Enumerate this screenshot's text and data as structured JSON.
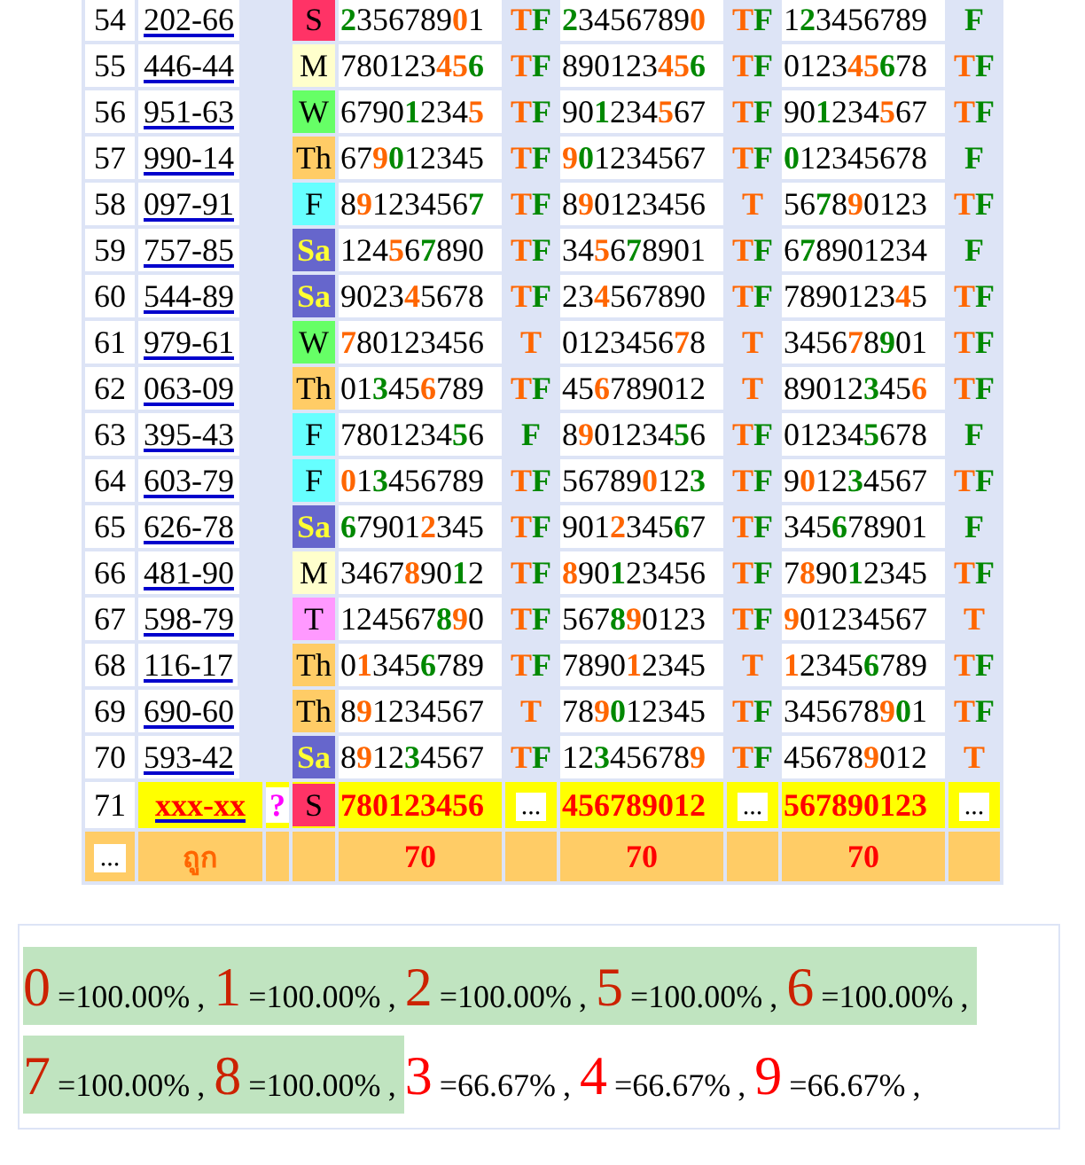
{
  "rows": [
    {
      "no": "54",
      "code": "202-66",
      "day": {
        "label": "S",
        "color": "#ff3366",
        "inverted": false
      },
      "cells": [
        {
          "digits": [
            {
              "text": "2",
              "color": "#008800"
            },
            {
              "text": "356789"
            },
            {
              "text": "0",
              "color": "#ff6600"
            },
            {
              "text": "1"
            }
          ],
          "result": [
            {
              "text": "T",
              "color": "#ff6600"
            },
            {
              "text": "F",
              "color": "#008800"
            }
          ]
        },
        {
          "digits": [
            {
              "text": "2",
              "color": "#008800"
            },
            {
              "text": "3456789"
            },
            {
              "text": "0",
              "color": "#ff6600"
            }
          ],
          "result": [
            {
              "text": "T",
              "color": "#ff6600"
            },
            {
              "text": "F",
              "color": "#008800"
            }
          ]
        },
        {
          "digits": [
            {
              "text": "1"
            },
            {
              "text": "2",
              "color": "#008800"
            },
            {
              "text": "3456789"
            }
          ],
          "result": [
            {
              "text": "F",
              "color": "#008800"
            }
          ]
        }
      ]
    },
    {
      "no": "55",
      "code": "446-44",
      "day": {
        "label": "M",
        "color": "#ffffcc",
        "inverted": false
      },
      "cells": [
        {
          "digits": [
            {
              "text": "780123"
            },
            {
              "text": "45",
              "color": "#ff6600"
            },
            {
              "text": "6",
              "color": "#008800"
            }
          ],
          "result": [
            {
              "text": "T",
              "color": "#ff6600"
            },
            {
              "text": "F",
              "color": "#008800"
            }
          ]
        },
        {
          "digits": [
            {
              "text": "890123"
            },
            {
              "text": "45",
              "color": "#ff6600"
            },
            {
              "text": "6",
              "color": "#008800"
            }
          ],
          "result": [
            {
              "text": "T",
              "color": "#ff6600"
            },
            {
              "text": "F",
              "color": "#008800"
            }
          ]
        },
        {
          "digits": [
            {
              "text": "0123"
            },
            {
              "text": "45",
              "color": "#ff6600"
            },
            {
              "text": "6",
              "color": "#008800"
            },
            {
              "text": "78"
            }
          ],
          "result": [
            {
              "text": "T",
              "color": "#ff6600"
            },
            {
              "text": "F",
              "color": "#008800"
            }
          ]
        }
      ]
    },
    {
      "no": "56",
      "code": "951-63",
      "day": {
        "label": "W",
        "color": "#66ff66",
        "inverted": false
      },
      "cells": [
        {
          "digits": [
            {
              "text": "6790"
            },
            {
              "text": "1",
              "color": "#008800"
            },
            {
              "text": "234"
            },
            {
              "text": "5",
              "color": "#ff6600"
            }
          ],
          "result": [
            {
              "text": "T",
              "color": "#ff6600"
            },
            {
              "text": "F",
              "color": "#008800"
            }
          ]
        },
        {
          "digits": [
            {
              "text": "90"
            },
            {
              "text": "1",
              "color": "#008800"
            },
            {
              "text": "234"
            },
            {
              "text": "5",
              "color": "#ff6600"
            },
            {
              "text": "67"
            }
          ],
          "result": [
            {
              "text": "T",
              "color": "#ff6600"
            },
            {
              "text": "F",
              "color": "#008800"
            }
          ]
        },
        {
          "digits": [
            {
              "text": "90"
            },
            {
              "text": "1",
              "color": "#008800"
            },
            {
              "text": "234"
            },
            {
              "text": "5",
              "color": "#ff6600"
            },
            {
              "text": "67"
            }
          ],
          "result": [
            {
              "text": "T",
              "color": "#ff6600"
            },
            {
              "text": "F",
              "color": "#008800"
            }
          ]
        }
      ]
    },
    {
      "no": "57",
      "code": "990-14",
      "day": {
        "label": "Th",
        "color": "#ffcc66",
        "inverted": false
      },
      "cells": [
        {
          "digits": [
            {
              "text": "67"
            },
            {
              "text": "9",
              "color": "#ff6600"
            },
            {
              "text": "0",
              "color": "#008800"
            },
            {
              "text": "12345"
            }
          ],
          "result": [
            {
              "text": "T",
              "color": "#ff6600"
            },
            {
              "text": "F",
              "color": "#008800"
            }
          ]
        },
        {
          "digits": [
            {
              "text": "9",
              "color": "#ff6600"
            },
            {
              "text": "0",
              "color": "#008800"
            },
            {
              "text": "1234567"
            }
          ],
          "result": [
            {
              "text": "T",
              "color": "#ff6600"
            },
            {
              "text": "F",
              "color": "#008800"
            }
          ]
        },
        {
          "digits": [
            {
              "text": "0",
              "color": "#008800"
            },
            {
              "text": "12345678"
            }
          ],
          "result": [
            {
              "text": "F",
              "color": "#008800"
            }
          ]
        }
      ]
    },
    {
      "no": "58",
      "code": "097-91",
      "day": {
        "label": "F",
        "color": "#66ffff",
        "inverted": false
      },
      "cells": [
        {
          "digits": [
            {
              "text": "8"
            },
            {
              "text": "9",
              "color": "#ff6600"
            },
            {
              "text": "123456"
            },
            {
              "text": "7",
              "color": "#008800"
            }
          ],
          "result": [
            {
              "text": "T",
              "color": "#ff6600"
            },
            {
              "text": "F",
              "color": "#008800"
            }
          ]
        },
        {
          "digits": [
            {
              "text": "8"
            },
            {
              "text": "9",
              "color": "#ff6600"
            },
            {
              "text": "0123456"
            }
          ],
          "result": [
            {
              "text": "T",
              "color": "#ff6600"
            }
          ]
        },
        {
          "digits": [
            {
              "text": "56"
            },
            {
              "text": "7",
              "color": "#008800"
            },
            {
              "text": "8"
            },
            {
              "text": "9",
              "color": "#ff6600"
            },
            {
              "text": "0123"
            }
          ],
          "result": [
            {
              "text": "T",
              "color": "#ff6600"
            },
            {
              "text": "F",
              "color": "#008800"
            }
          ]
        }
      ]
    },
    {
      "no": "59",
      "code": "757-85",
      "day": {
        "label": "Sa",
        "color": "#6666cc",
        "inverted": true
      },
      "cells": [
        {
          "digits": [
            {
              "text": "124"
            },
            {
              "text": "5",
              "color": "#ff6600"
            },
            {
              "text": "6"
            },
            {
              "text": "7",
              "color": "#008800"
            },
            {
              "text": "890"
            }
          ],
          "result": [
            {
              "text": "T",
              "color": "#ff6600"
            },
            {
              "text": "F",
              "color": "#008800"
            }
          ]
        },
        {
          "digits": [
            {
              "text": "34"
            },
            {
              "text": "5",
              "color": "#ff6600"
            },
            {
              "text": "6"
            },
            {
              "text": "7",
              "color": "#008800"
            },
            {
              "text": "8901"
            }
          ],
          "result": [
            {
              "text": "T",
              "color": "#ff6600"
            },
            {
              "text": "F",
              "color": "#008800"
            }
          ]
        },
        {
          "digits": [
            {
              "text": "6"
            },
            {
              "text": "7",
              "color": "#008800"
            },
            {
              "text": "8901234"
            }
          ],
          "result": [
            {
              "text": "F",
              "color": "#008800"
            }
          ]
        }
      ]
    },
    {
      "no": "60",
      "code": "544-89",
      "day": {
        "label": "Sa",
        "color": "#6666cc",
        "inverted": true
      },
      "cells": [
        {
          "digits": [
            {
              "text": "9023"
            },
            {
              "text": "4",
              "color": "#ff6600"
            },
            {
              "text": "5678"
            }
          ],
          "result": [
            {
              "text": "T",
              "color": "#ff6600"
            },
            {
              "text": "F",
              "color": "#008800"
            }
          ]
        },
        {
          "digits": [
            {
              "text": "23"
            },
            {
              "text": "4",
              "color": "#ff6600"
            },
            {
              "text": "567890"
            }
          ],
          "result": [
            {
              "text": "T",
              "color": "#ff6600"
            },
            {
              "text": "F",
              "color": "#008800"
            }
          ]
        },
        {
          "digits": [
            {
              "text": "7890123"
            },
            {
              "text": "4",
              "color": "#ff6600"
            },
            {
              "text": "5"
            }
          ],
          "result": [
            {
              "text": "T",
              "color": "#ff6600"
            },
            {
              "text": "F",
              "color": "#008800"
            }
          ]
        }
      ]
    },
    {
      "no": "61",
      "code": "979-61",
      "day": {
        "label": "W",
        "color": "#66ff66",
        "inverted": false
      },
      "cells": [
        {
          "digits": [
            {
              "text": "7",
              "color": "#ff6600"
            },
            {
              "text": "80123456"
            }
          ],
          "result": [
            {
              "text": "T",
              "color": "#ff6600"
            }
          ]
        },
        {
          "digits": [
            {
              "text": "0123456"
            },
            {
              "text": "7",
              "color": "#ff6600"
            },
            {
              "text": "8"
            }
          ],
          "result": [
            {
              "text": "T",
              "color": "#ff6600"
            }
          ]
        },
        {
          "digits": [
            {
              "text": "3456"
            },
            {
              "text": "7",
              "color": "#ff6600"
            },
            {
              "text": "8"
            },
            {
              "text": "9",
              "color": "#008800"
            },
            {
              "text": "01"
            }
          ],
          "result": [
            {
              "text": "T",
              "color": "#ff6600"
            },
            {
              "text": "F",
              "color": "#008800"
            }
          ]
        }
      ]
    },
    {
      "no": "62",
      "code": "063-09",
      "day": {
        "label": "Th",
        "color": "#ffcc66",
        "inverted": false
      },
      "cells": [
        {
          "digits": [
            {
              "text": "01"
            },
            {
              "text": "3",
              "color": "#008800"
            },
            {
              "text": "45"
            },
            {
              "text": "6",
              "color": "#ff6600"
            },
            {
              "text": "789"
            }
          ],
          "result": [
            {
              "text": "T",
              "color": "#ff6600"
            },
            {
              "text": "F",
              "color": "#008800"
            }
          ]
        },
        {
          "digits": [
            {
              "text": "45"
            },
            {
              "text": "6",
              "color": "#ff6600"
            },
            {
              "text": "789012"
            }
          ],
          "result": [
            {
              "text": "T",
              "color": "#ff6600"
            }
          ]
        },
        {
          "digits": [
            {
              "text": "89012"
            },
            {
              "text": "3",
              "color": "#008800"
            },
            {
              "text": "45"
            },
            {
              "text": "6",
              "color": "#ff6600"
            }
          ],
          "result": [
            {
              "text": "T",
              "color": "#ff6600"
            },
            {
              "text": "F",
              "color": "#008800"
            }
          ]
        }
      ]
    },
    {
      "no": "63",
      "code": "395-43",
      "day": {
        "label": "F",
        "color": "#66ffff",
        "inverted": false
      },
      "cells": [
        {
          "digits": [
            {
              "text": "7801234"
            },
            {
              "text": "5",
              "color": "#008800"
            },
            {
              "text": "6"
            }
          ],
          "result": [
            {
              "text": "F",
              "color": "#008800"
            }
          ]
        },
        {
          "digits": [
            {
              "text": "8"
            },
            {
              "text": "9",
              "color": "#ff6600"
            },
            {
              "text": "01234"
            },
            {
              "text": "5",
              "color": "#008800"
            },
            {
              "text": "6"
            }
          ],
          "result": [
            {
              "text": "T",
              "color": "#ff6600"
            },
            {
              "text": "F",
              "color": "#008800"
            }
          ]
        },
        {
          "digits": [
            {
              "text": "01234"
            },
            {
              "text": "5",
              "color": "#008800"
            },
            {
              "text": "678"
            }
          ],
          "result": [
            {
              "text": "F",
              "color": "#008800"
            }
          ]
        }
      ]
    },
    {
      "no": "64",
      "code": "603-79",
      "day": {
        "label": "F",
        "color": "#66ffff",
        "inverted": false
      },
      "cells": [
        {
          "digits": [
            {
              "text": "0",
              "color": "#ff6600"
            },
            {
              "text": "1"
            },
            {
              "text": "3",
              "color": "#008800"
            },
            {
              "text": "456789"
            }
          ],
          "result": [
            {
              "text": "T",
              "color": "#ff6600"
            },
            {
              "text": "F",
              "color": "#008800"
            }
          ]
        },
        {
          "digits": [
            {
              "text": "56789"
            },
            {
              "text": "0",
              "color": "#ff6600"
            },
            {
              "text": "12"
            },
            {
              "text": "3",
              "color": "#008800"
            }
          ],
          "result": [
            {
              "text": "T",
              "color": "#ff6600"
            },
            {
              "text": "F",
              "color": "#008800"
            }
          ]
        },
        {
          "digits": [
            {
              "text": "9"
            },
            {
              "text": "0",
              "color": "#ff6600"
            },
            {
              "text": "12"
            },
            {
              "text": "3",
              "color": "#008800"
            },
            {
              "text": "4567"
            }
          ],
          "result": [
            {
              "text": "T",
              "color": "#ff6600"
            },
            {
              "text": "F",
              "color": "#008800"
            }
          ]
        }
      ]
    },
    {
      "no": "65",
      "code": "626-78",
      "day": {
        "label": "Sa",
        "color": "#6666cc",
        "inverted": true
      },
      "cells": [
        {
          "digits": [
            {
              "text": "6",
              "color": "#008800"
            },
            {
              "text": "7901"
            },
            {
              "text": "2",
              "color": "#ff6600"
            },
            {
              "text": "345"
            }
          ],
          "result": [
            {
              "text": "T",
              "color": "#ff6600"
            },
            {
              "text": "F",
              "color": "#008800"
            }
          ]
        },
        {
          "digits": [
            {
              "text": "901"
            },
            {
              "text": "2",
              "color": "#ff6600"
            },
            {
              "text": "345"
            },
            {
              "text": "6",
              "color": "#008800"
            },
            {
              "text": "7"
            }
          ],
          "result": [
            {
              "text": "T",
              "color": "#ff6600"
            },
            {
              "text": "F",
              "color": "#008800"
            }
          ]
        },
        {
          "digits": [
            {
              "text": "345"
            },
            {
              "text": "6",
              "color": "#008800"
            },
            {
              "text": "78901"
            }
          ],
          "result": [
            {
              "text": "F",
              "color": "#008800"
            }
          ]
        }
      ]
    },
    {
      "no": "66",
      "code": "481-90",
      "day": {
        "label": "M",
        "color": "#ffffcc",
        "inverted": false
      },
      "cells": [
        {
          "digits": [
            {
              "text": "3467"
            },
            {
              "text": "8",
              "color": "#ff6600"
            },
            {
              "text": "90"
            },
            {
              "text": "1",
              "color": "#008800"
            },
            {
              "text": "2"
            }
          ],
          "result": [
            {
              "text": "T",
              "color": "#ff6600"
            },
            {
              "text": "F",
              "color": "#008800"
            }
          ]
        },
        {
          "digits": [
            {
              "text": "8",
              "color": "#ff6600"
            },
            {
              "text": "90"
            },
            {
              "text": "1",
              "color": "#008800"
            },
            {
              "text": "23456"
            }
          ],
          "result": [
            {
              "text": "T",
              "color": "#ff6600"
            },
            {
              "text": "F",
              "color": "#008800"
            }
          ]
        },
        {
          "digits": [
            {
              "text": "7"
            },
            {
              "text": "8",
              "color": "#ff6600"
            },
            {
              "text": "90"
            },
            {
              "text": "1",
              "color": "#008800"
            },
            {
              "text": "2345"
            }
          ],
          "result": [
            {
              "text": "T",
              "color": "#ff6600"
            },
            {
              "text": "F",
              "color": "#008800"
            }
          ]
        }
      ]
    },
    {
      "no": "67",
      "code": "598-79",
      "day": {
        "label": "T",
        "color": "#ff99ff",
        "inverted": false
      },
      "cells": [
        {
          "digits": [
            {
              "text": "124567"
            },
            {
              "text": "8",
              "color": "#008800"
            },
            {
              "text": "9",
              "color": "#ff6600"
            },
            {
              "text": "0"
            }
          ],
          "result": [
            {
              "text": "T",
              "color": "#ff6600"
            },
            {
              "text": "F",
              "color": "#008800"
            }
          ]
        },
        {
          "digits": [
            {
              "text": "567"
            },
            {
              "text": "8",
              "color": "#008800"
            },
            {
              "text": "9",
              "color": "#ff6600"
            },
            {
              "text": "0123"
            }
          ],
          "result": [
            {
              "text": "T",
              "color": "#ff6600"
            },
            {
              "text": "F",
              "color": "#008800"
            }
          ]
        },
        {
          "digits": [
            {
              "text": "9",
              "color": "#ff6600"
            },
            {
              "text": "01234567"
            }
          ],
          "result": [
            {
              "text": "T",
              "color": "#ff6600"
            }
          ]
        }
      ]
    },
    {
      "no": "68",
      "code": "116-17",
      "day": {
        "label": "Th",
        "color": "#ffcc66",
        "inverted": false
      },
      "cells": [
        {
          "digits": [
            {
              "text": "0"
            },
            {
              "text": "1",
              "color": "#ff6600"
            },
            {
              "text": "345"
            },
            {
              "text": "6",
              "color": "#008800"
            },
            {
              "text": "789"
            }
          ],
          "result": [
            {
              "text": "T",
              "color": "#ff6600"
            },
            {
              "text": "F",
              "color": "#008800"
            }
          ]
        },
        {
          "digits": [
            {
              "text": "7890"
            },
            {
              "text": "1",
              "color": "#ff6600"
            },
            {
              "text": "2345"
            }
          ],
          "result": [
            {
              "text": "T",
              "color": "#ff6600"
            }
          ]
        },
        {
          "digits": [
            {
              "text": "1",
              "color": "#ff6600"
            },
            {
              "text": "2345"
            },
            {
              "text": "6",
              "color": "#008800"
            },
            {
              "text": "789"
            }
          ],
          "result": [
            {
              "text": "T",
              "color": "#ff6600"
            },
            {
              "text": "F",
              "color": "#008800"
            }
          ]
        }
      ]
    },
    {
      "no": "69",
      "code": "690-60",
      "day": {
        "label": "Th",
        "color": "#ffcc66",
        "inverted": false
      },
      "cells": [
        {
          "digits": [
            {
              "text": "8"
            },
            {
              "text": "9",
              "color": "#ff6600"
            },
            {
              "text": "1234567"
            }
          ],
          "result": [
            {
              "text": "T",
              "color": "#ff6600"
            }
          ]
        },
        {
          "digits": [
            {
              "text": "78"
            },
            {
              "text": "9",
              "color": "#ff6600"
            },
            {
              "text": "0",
              "color": "#008800"
            },
            {
              "text": "12345"
            }
          ],
          "result": [
            {
              "text": "T",
              "color": "#ff6600"
            },
            {
              "text": "F",
              "color": "#008800"
            }
          ]
        },
        {
          "digits": [
            {
              "text": "345678"
            },
            {
              "text": "9",
              "color": "#ff6600"
            },
            {
              "text": "0",
              "color": "#008800"
            },
            {
              "text": "1"
            }
          ],
          "result": [
            {
              "text": "T",
              "color": "#ff6600"
            },
            {
              "text": "F",
              "color": "#008800"
            }
          ]
        }
      ]
    },
    {
      "no": "70",
      "code": "593-42",
      "day": {
        "label": "Sa",
        "color": "#6666cc",
        "inverted": true
      },
      "cells": [
        {
          "digits": [
            {
              "text": "8"
            },
            {
              "text": "9",
              "color": "#ff6600"
            },
            {
              "text": "12"
            },
            {
              "text": "3",
              "color": "#008800"
            },
            {
              "text": "4567"
            }
          ],
          "result": [
            {
              "text": "T",
              "color": "#ff6600"
            },
            {
              "text": "F",
              "color": "#008800"
            }
          ]
        },
        {
          "digits": [
            {
              "text": "12"
            },
            {
              "text": "3",
              "color": "#008800"
            },
            {
              "text": "45678"
            },
            {
              "text": "9",
              "color": "#ff6600"
            }
          ],
          "result": [
            {
              "text": "T",
              "color": "#ff6600"
            },
            {
              "text": "F",
              "color": "#008800"
            }
          ]
        },
        {
          "digits": [
            {
              "text": "45678"
            },
            {
              "text": "9",
              "color": "#ff6600"
            },
            {
              "text": "012"
            }
          ],
          "result": [
            {
              "text": "T",
              "color": "#ff6600"
            }
          ]
        }
      ]
    }
  ],
  "next_row": {
    "no": "71",
    "code": "xxx-xx",
    "mark": "?",
    "day": {
      "label": "S",
      "color": "#ff3366",
      "inverted": false
    },
    "cells": [
      {
        "digits": "780123456",
        "result": "..."
      },
      {
        "digits": "456789012",
        "result": "..."
      },
      {
        "digits": "567890123",
        "result": "..."
      }
    ]
  },
  "footer": {
    "first": "...",
    "label": "ถูก",
    "counts": [
      "70",
      "70",
      "70"
    ]
  },
  "summary": [
    [
      {
        "digit": "0",
        "value": "=100.00%",
        "sep": ",",
        "highlighted": true
      },
      {
        "digit": "1",
        "value": "=100.00%",
        "sep": ",",
        "highlighted": true
      },
      {
        "digit": "2",
        "value": "=100.00%",
        "sep": ",",
        "highlighted": true
      },
      {
        "digit": "5",
        "value": "=100.00%",
        "sep": ",",
        "highlighted": true
      },
      {
        "digit": "6",
        "value": "=100.00%",
        "sep": ",",
        "highlighted": true
      }
    ],
    [
      {
        "digit": "7",
        "value": "=100.00%",
        "sep": ",",
        "highlighted": true
      },
      {
        "digit": "8",
        "value": "=100.00%",
        "sep": ",",
        "highlighted": true
      },
      {
        "digit": "3",
        "value": "=66.67%",
        "sep": ",",
        "highlighted": false
      },
      {
        "digit": "4",
        "value": "=66.67%",
        "sep": ",",
        "highlighted": false
      },
      {
        "digit": "9",
        "value": "=66.67%",
        "sep": ",",
        "highlighted": false
      }
    ]
  ]
}
